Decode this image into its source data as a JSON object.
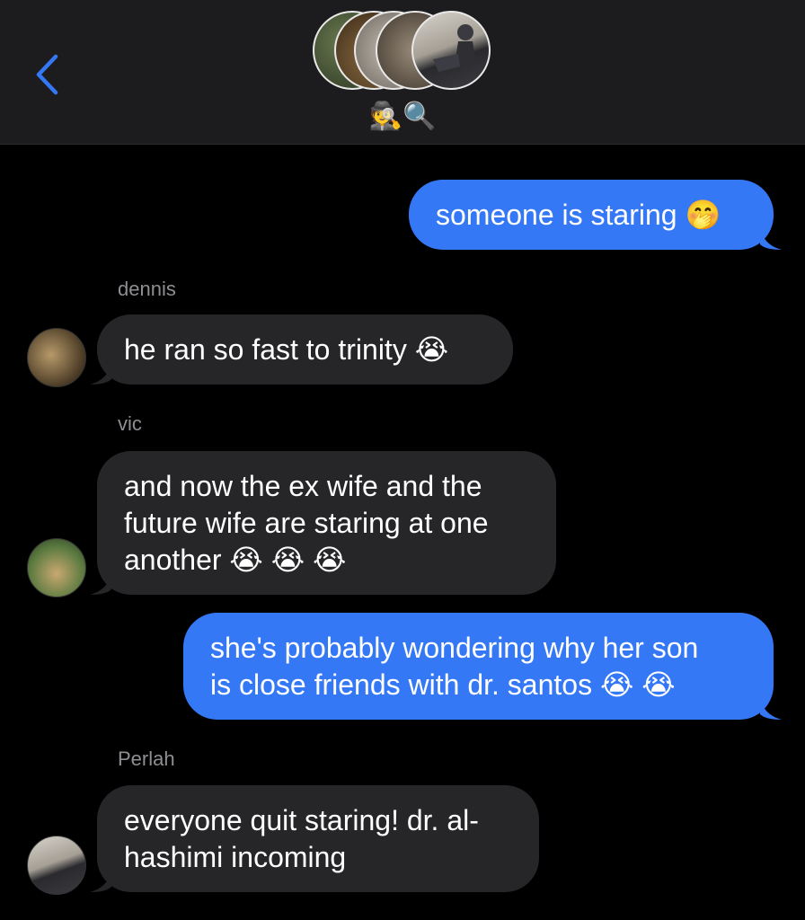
{
  "header": {
    "group_title": "🕵🔍",
    "back_icon": "chevron-left-icon",
    "accent": "#3478f6"
  },
  "messages": [
    {
      "direction": "sent",
      "text": "someone is staring 🤭"
    },
    {
      "direction": "received",
      "sender": "dennis",
      "text": "he ran so fast to trinity 😭"
    },
    {
      "direction": "received",
      "sender": "vic",
      "lines": [
        "and now the ex wife and the",
        "future wife are staring at one",
        "another 😭 😭 😭"
      ]
    },
    {
      "direction": "sent",
      "lines": [
        "she's probably wondering why her son",
        "is close friends with dr. santos 😭 😭"
      ]
    },
    {
      "direction": "received",
      "sender": "Perlah",
      "lines": [
        "everyone quit staring! dr. al-",
        "hashimi incoming"
      ]
    }
  ],
  "colors": {
    "sent_bubble": "#3478f6",
    "received_bubble": "#262629",
    "background": "#000000",
    "header_bg": "#1c1c1e",
    "sender_name": "#8e8e93"
  }
}
